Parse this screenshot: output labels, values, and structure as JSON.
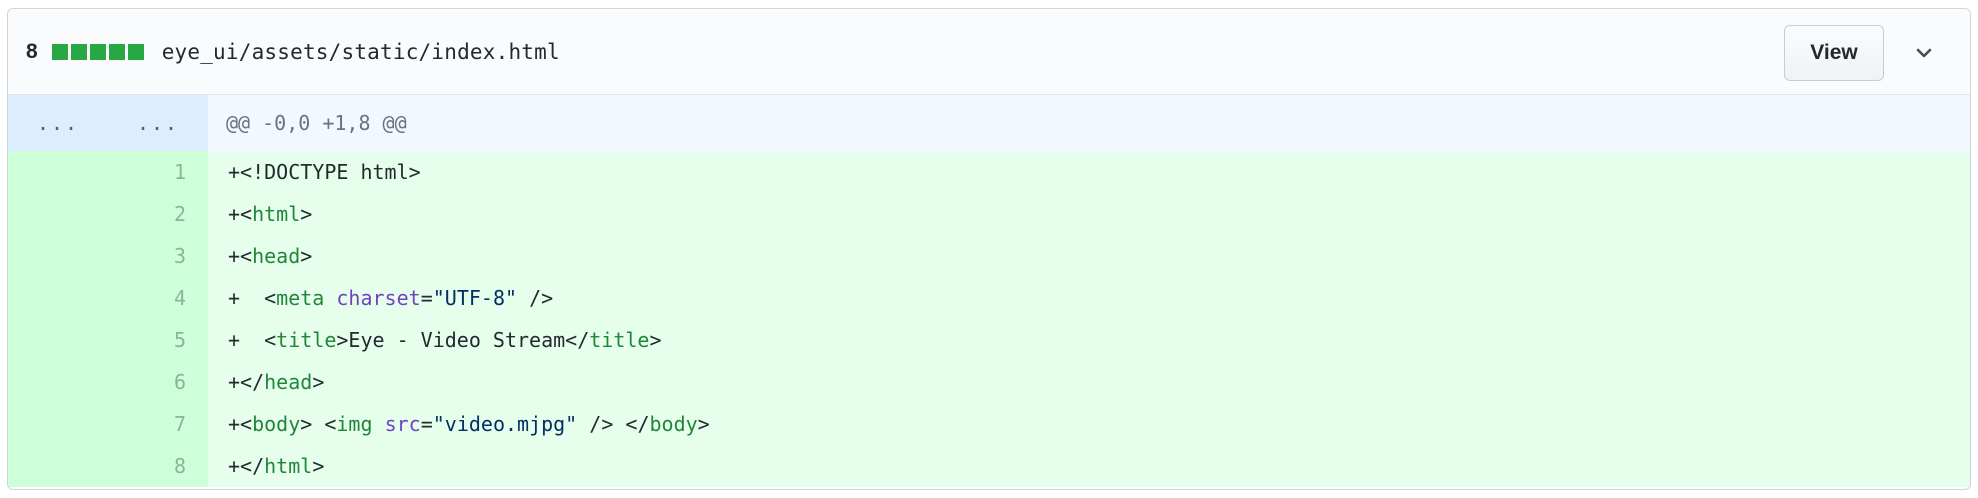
{
  "file": {
    "diffstat_count": "8",
    "diffstat_blocks": 5,
    "path": "eye_ui/assets/static/index.html",
    "view_label": "View"
  },
  "hunk": {
    "old_marker": "...",
    "new_marker": "...",
    "header": "@@ -0,0 +1,8 @@"
  },
  "lines": [
    {
      "num": "1",
      "tokens": [
        [
          "p",
          "+"
        ],
        [
          "x",
          "<!DOCTYPE html>"
        ]
      ]
    },
    {
      "num": "2",
      "tokens": [
        [
          "p",
          "+"
        ],
        [
          "x",
          "<"
        ],
        [
          "t",
          "html"
        ],
        [
          "x",
          ">"
        ]
      ]
    },
    {
      "num": "3",
      "tokens": [
        [
          "p",
          "+"
        ],
        [
          "x",
          "<"
        ],
        [
          "t",
          "head"
        ],
        [
          "x",
          ">"
        ]
      ]
    },
    {
      "num": "4",
      "tokens": [
        [
          "p",
          "+"
        ],
        [
          "x",
          "  <"
        ],
        [
          "t",
          "meta"
        ],
        [
          "x",
          " "
        ],
        [
          "a",
          "charset"
        ],
        [
          "x",
          "="
        ],
        [
          "s",
          "\"UTF-8\""
        ],
        [
          "x",
          " />"
        ]
      ]
    },
    {
      "num": "5",
      "tokens": [
        [
          "p",
          "+"
        ],
        [
          "x",
          "  <"
        ],
        [
          "t",
          "title"
        ],
        [
          "x",
          ">Eye - Video Stream</"
        ],
        [
          "t",
          "title"
        ],
        [
          "x",
          ">"
        ]
      ]
    },
    {
      "num": "6",
      "tokens": [
        [
          "p",
          "+"
        ],
        [
          "x",
          "</"
        ],
        [
          "t",
          "head"
        ],
        [
          "x",
          ">"
        ]
      ]
    },
    {
      "num": "7",
      "tokens": [
        [
          "p",
          "+"
        ],
        [
          "x",
          "<"
        ],
        [
          "t",
          "body"
        ],
        [
          "x",
          "> <"
        ],
        [
          "t",
          "img"
        ],
        [
          "x",
          " "
        ],
        [
          "a",
          "src"
        ],
        [
          "x",
          "="
        ],
        [
          "s",
          "\"video.mjpg\""
        ],
        [
          "x",
          " /> </"
        ],
        [
          "t",
          "body"
        ],
        [
          "x",
          ">"
        ]
      ]
    },
    {
      "num": "8",
      "tokens": [
        [
          "p",
          "+"
        ],
        [
          "x",
          "</"
        ],
        [
          "t",
          "html"
        ],
        [
          "x",
          ">"
        ]
      ]
    }
  ],
  "colors": {
    "addition_bg": "#e6ffed",
    "addition_num_bg": "#cdffd8",
    "hunk_bg": "#f1f8ff",
    "diffstat_green": "#28a745",
    "tag": "#22863a",
    "attr": "#6f42c1",
    "string": "#032f62"
  },
  "icons": {
    "expand": "chevron-down-icon"
  }
}
